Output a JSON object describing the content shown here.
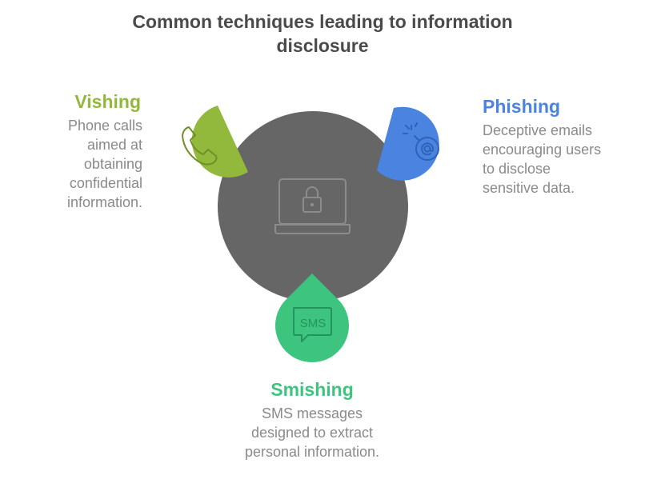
{
  "title": {
    "line1": "Common techniques leading to information",
    "line2": "disclosure"
  },
  "center": {
    "icon": "laptop-lock-icon",
    "color": "#666666"
  },
  "techniques": {
    "vishing": {
      "heading": "Vishing",
      "description": [
        "Phone calls",
        "aimed at",
        "obtaining",
        "confidential",
        "information."
      ],
      "color": "#92b83c",
      "icon": "phone-icon"
    },
    "phishing": {
      "heading": "Phishing",
      "description": [
        "Deceptive emails",
        "encouraging users",
        "to disclose",
        "sensitive data."
      ],
      "color": "#4a84e0",
      "icon": "email-bomb-icon"
    },
    "smishing": {
      "heading": "Smishing",
      "description": [
        "SMS messages",
        "designed to extract",
        "personal information."
      ],
      "color": "#3dc47e",
      "icon": "sms-icon",
      "icon_text": "SMS"
    }
  }
}
